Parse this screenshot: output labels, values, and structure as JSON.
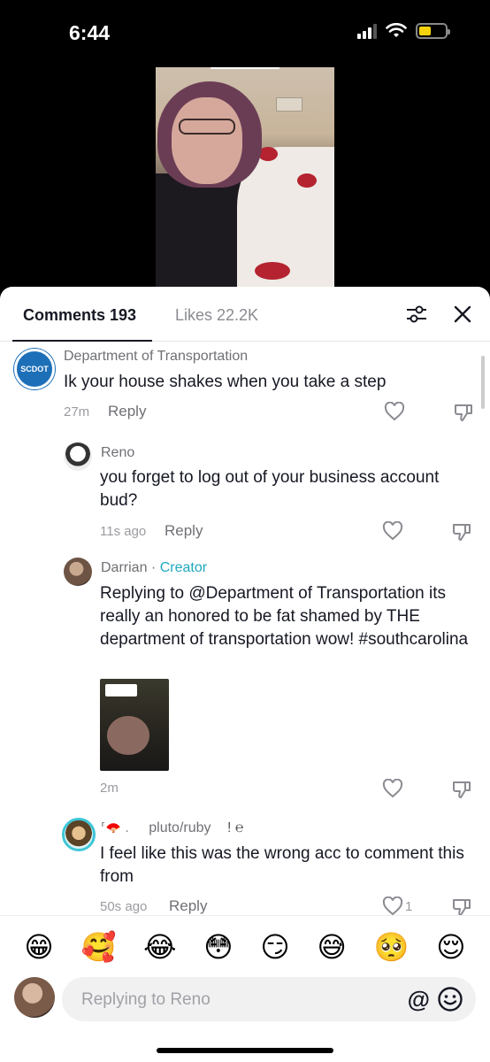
{
  "status": {
    "time": "6:44"
  },
  "tabs": {
    "comments": "Comments 193",
    "likes": "Likes 22.2K"
  },
  "comments": [
    {
      "name": "Department of Transportation",
      "text": "Ik your house shakes when you take a step",
      "time": "27m",
      "reply": "Reply",
      "avatar_text": "SCDOT"
    },
    {
      "name": "Reno",
      "text": "you forget to log out of your business account bud?",
      "time": "11s ago",
      "reply": "Reply"
    },
    {
      "name": "Darrian",
      "separator": " · ",
      "badge": "Creator",
      "text": "Replying to @Department of Transportation its really an honored to be fat shamed by THE department of transportation wow! #southcarolina",
      "time": "2m"
    },
    {
      "name_prefix": "⸢🪭 .",
      "name": "pluto/ruby",
      "name_suffix": "! ℮",
      "text": "I feel like this was the wrong acc to comment this from",
      "time": "50s ago",
      "reply": "Reply",
      "likes": "1"
    }
  ],
  "emojis": [
    "😁",
    "🥰",
    "😂",
    "😳",
    "😏",
    "😅",
    "🥺",
    "😌"
  ],
  "input": {
    "placeholder": "Replying to Reno",
    "at": "@"
  },
  "icons": [
    "filter-icon",
    "close-icon",
    "heart-icon",
    "dislike-icon",
    "smile-icon",
    "signal-icon",
    "wifi-icon",
    "battery-icon"
  ],
  "colors": {
    "creator": "#20a8c1",
    "battery": "#f5d30c",
    "scdot_blue": "#1d6fb8"
  }
}
